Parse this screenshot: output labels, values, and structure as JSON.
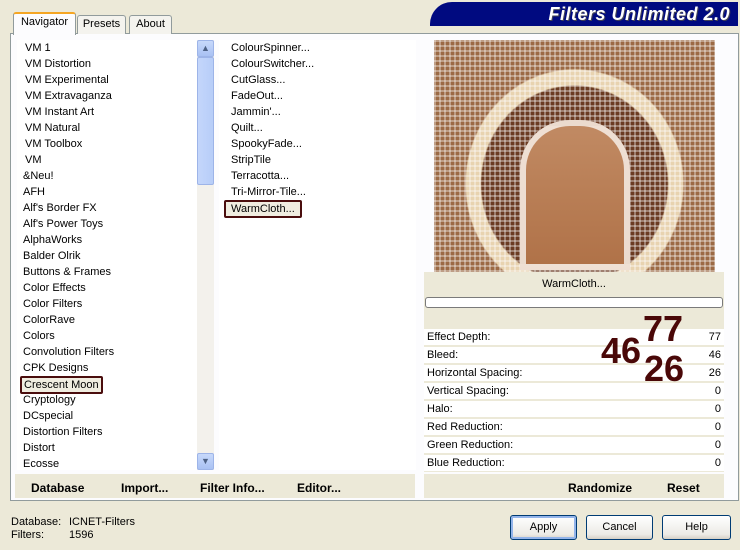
{
  "app_title": "Filters Unlimited 2.0",
  "tabs": [
    {
      "label": "Navigator"
    },
    {
      "label": "Presets"
    },
    {
      "label": "About"
    }
  ],
  "categories": [
    "VM 1",
    "VM Distortion",
    "VM Experimental",
    "VM Extravaganza",
    "VM Instant Art",
    "VM Natural",
    "VM Toolbox",
    "VM",
    "&Neu!",
    "AFH",
    "Alf's Border FX",
    "Alf's Power Toys",
    "AlphaWorks",
    "Balder Olrik",
    "Buttons & Frames",
    "Color Effects",
    "Color Filters",
    "ColorRave",
    "Colors",
    "Convolution Filters",
    "CPK Designs",
    "Crescent Moon",
    "Cryptology",
    "DCspecial",
    "Distortion Filters",
    "Distort",
    "Ecosse"
  ],
  "selected_category": "Crescent Moon",
  "filters": [
    "ColourSpinner...",
    "ColourSwitcher...",
    "CutGlass...",
    "FadeOut...",
    "Jammin'...",
    "Quilt...",
    "SpookyFade...",
    "StripTile",
    "Terracotta...",
    "Tri-Mirror-Tile...",
    "WarmCloth..."
  ],
  "selected_filter": "WarmCloth...",
  "preview_caption": "WarmCloth...",
  "progress_percent": 0,
  "params": [
    {
      "label": "Effect Depth:",
      "value": "77"
    },
    {
      "label": "Bleed:",
      "value": "46"
    },
    {
      "label": "Horizontal Spacing:",
      "value": "26"
    },
    {
      "label": "Vertical Spacing:",
      "value": "0"
    },
    {
      "label": "Halo:",
      "value": "0"
    },
    {
      "label": "Red Reduction:",
      "value": "0"
    },
    {
      "label": "Green Reduction:",
      "value": "0"
    },
    {
      "label": "Blue Reduction:",
      "value": "0"
    }
  ],
  "overlay": {
    "a": "77",
    "b": "46",
    "c": "26"
  },
  "toolbar": {
    "database": "Database",
    "import": "Import...",
    "filter_info": "Filter Info...",
    "editor": "Editor...",
    "randomize": "Randomize",
    "reset": "Reset"
  },
  "status": {
    "database_label": "Database:",
    "database_value": "ICNET-Filters",
    "filters_label": "Filters:",
    "filters_value": "1596"
  },
  "buttons": {
    "apply": "Apply",
    "cancel": "Cancel",
    "help": "Help"
  },
  "colors": {
    "banner": "#000a80",
    "highlight": "#4a0808"
  }
}
